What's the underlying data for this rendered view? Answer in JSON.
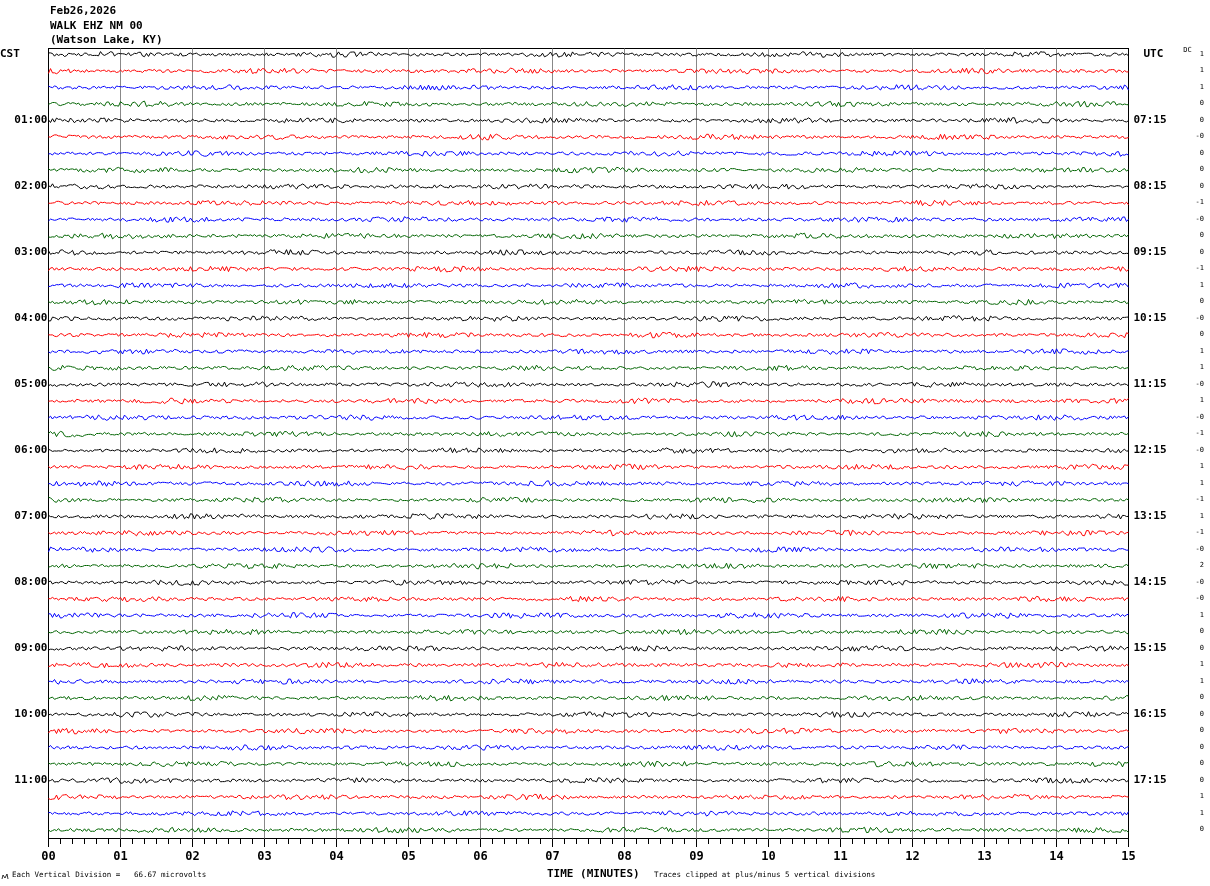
{
  "header": {
    "date": "Feb26,2026",
    "station": "WALK EHZ NM 00",
    "location": "(Watson Lake, KY)"
  },
  "left_header": "CST",
  "right_header": "UTC",
  "dc_header": "DC",
  "traces": [
    {
      "color": "#000000",
      "dc": "1"
    },
    {
      "color": "#ff0000",
      "dc": "1"
    },
    {
      "color": "#0000ff",
      "dc": "1"
    },
    {
      "color": "#006400",
      "dc": "0"
    },
    {
      "color": "#000000",
      "dc": "0",
      "cst": "01:00",
      "utc": "07:15"
    },
    {
      "color": "#ff0000",
      "dc": "-0"
    },
    {
      "color": "#0000ff",
      "dc": "0"
    },
    {
      "color": "#006400",
      "dc": "0"
    },
    {
      "color": "#000000",
      "dc": "0",
      "cst": "02:00",
      "utc": "08:15"
    },
    {
      "color": "#ff0000",
      "dc": "-1"
    },
    {
      "color": "#0000ff",
      "dc": "-0"
    },
    {
      "color": "#006400",
      "dc": "0"
    },
    {
      "color": "#000000",
      "dc": "0",
      "cst": "03:00",
      "utc": "09:15"
    },
    {
      "color": "#ff0000",
      "dc": "-1"
    },
    {
      "color": "#0000ff",
      "dc": "1"
    },
    {
      "color": "#006400",
      "dc": "0"
    },
    {
      "color": "#000000",
      "dc": "-0",
      "cst": "04:00",
      "utc": "10:15"
    },
    {
      "color": "#ff0000",
      "dc": "0"
    },
    {
      "color": "#0000ff",
      "dc": "1"
    },
    {
      "color": "#006400",
      "dc": "1"
    },
    {
      "color": "#000000",
      "dc": "-0",
      "cst": "05:00",
      "utc": "11:15"
    },
    {
      "color": "#ff0000",
      "dc": "1"
    },
    {
      "color": "#0000ff",
      "dc": "-0"
    },
    {
      "color": "#006400",
      "dc": "-1"
    },
    {
      "color": "#000000",
      "dc": "-0",
      "cst": "06:00",
      "utc": "12:15"
    },
    {
      "color": "#ff0000",
      "dc": "1"
    },
    {
      "color": "#0000ff",
      "dc": "1"
    },
    {
      "color": "#006400",
      "dc": "-1"
    },
    {
      "color": "#000000",
      "dc": "1",
      "cst": "07:00",
      "utc": "13:15"
    },
    {
      "color": "#ff0000",
      "dc": "-1"
    },
    {
      "color": "#0000ff",
      "dc": "-0"
    },
    {
      "color": "#006400",
      "dc": "2"
    },
    {
      "color": "#000000",
      "dc": "-0",
      "cst": "08:00",
      "utc": "14:15"
    },
    {
      "color": "#ff0000",
      "dc": "-0"
    },
    {
      "color": "#0000ff",
      "dc": "1"
    },
    {
      "color": "#006400",
      "dc": "0"
    },
    {
      "color": "#000000",
      "dc": "0",
      "cst": "09:00",
      "utc": "15:15"
    },
    {
      "color": "#ff0000",
      "dc": "1"
    },
    {
      "color": "#0000ff",
      "dc": "1"
    },
    {
      "color": "#006400",
      "dc": "0"
    },
    {
      "color": "#000000",
      "dc": "0",
      "cst": "10:00",
      "utc": "16:15"
    },
    {
      "color": "#ff0000",
      "dc": "0"
    },
    {
      "color": "#0000ff",
      "dc": "0"
    },
    {
      "color": "#006400",
      "dc": "0"
    },
    {
      "color": "#000000",
      "dc": "0",
      "cst": "11:00",
      "utc": "17:15"
    },
    {
      "color": "#ff0000",
      "dc": "1"
    },
    {
      "color": "#0000ff",
      "dc": "1"
    },
    {
      "color": "#006400",
      "dc": "0"
    }
  ],
  "x_ticks": [
    "00",
    "01",
    "02",
    "03",
    "04",
    "05",
    "06",
    "07",
    "08",
    "09",
    "10",
    "11",
    "12",
    "13",
    "14",
    "15"
  ],
  "x_label": "TIME (MINUTES)",
  "footer": {
    "division_note": "Each Vertical Division =   66.67 microvolts",
    "clip_note": "Traces clipped at plus/minus 5 vertical divisions"
  }
}
